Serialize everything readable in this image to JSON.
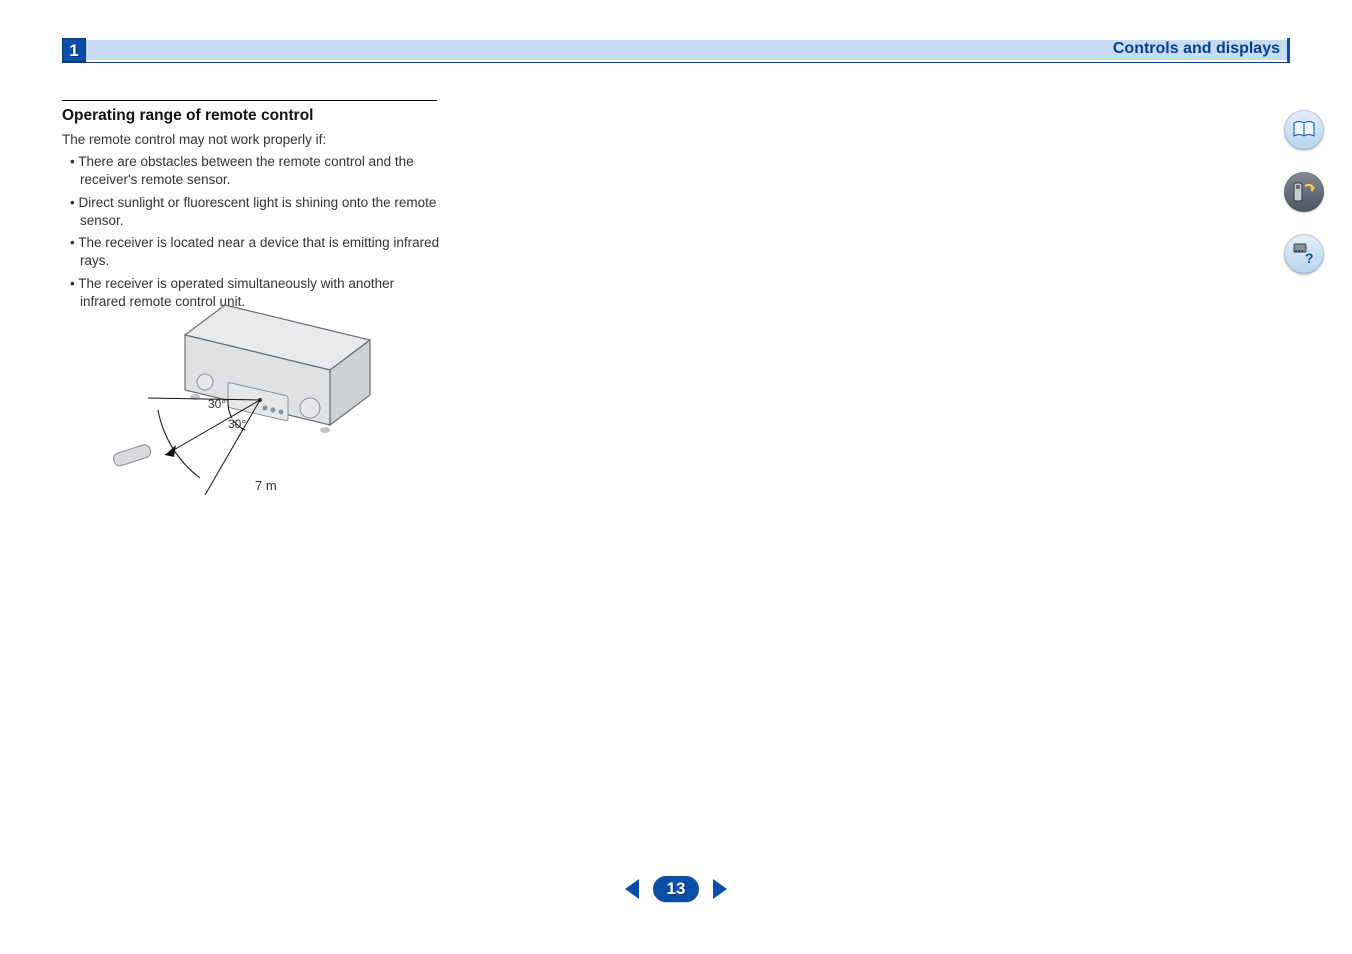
{
  "header": {
    "chapter_number": "1",
    "section_title": "Controls and displays"
  },
  "content": {
    "subheading": "Operating range of remote control",
    "intro": "The remote control may not work properly if:",
    "bullets": [
      "There are obstacles between the remote control and the receiver's remote sensor.",
      "Direct sunlight or fluorescent light is shining onto the remote sensor.",
      "The receiver is located near a device that is emitting infrared rays.",
      "The receiver is operated simultaneously with another infrared remote control unit."
    ]
  },
  "diagram": {
    "angle_upper": "30°",
    "angle_lower": "30°",
    "distance": "7 m"
  },
  "pager": {
    "page_number": "13"
  },
  "sidebar": {
    "icons": {
      "book": "book-icon",
      "remote": "remote-icon",
      "help": "help-icon"
    }
  }
}
